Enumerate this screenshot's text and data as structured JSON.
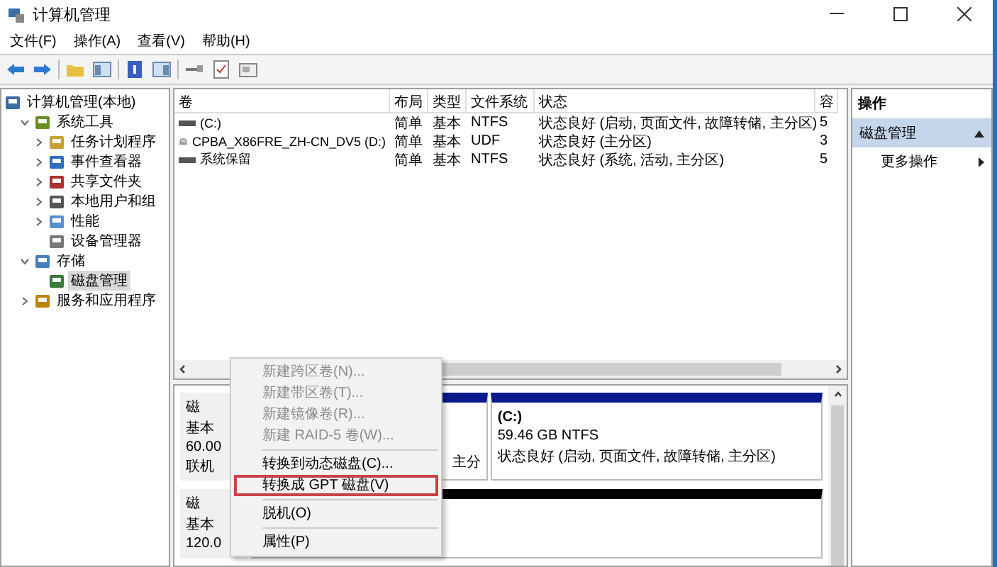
{
  "window": {
    "title": "计算机管理"
  },
  "menu_bar": [
    "文件(F)",
    "操作(A)",
    "查看(V)",
    "帮助(H)"
  ],
  "tree": [
    {
      "label": "计算机管理(本地)",
      "kind": "root",
      "selected": false,
      "children": [
        {
          "label": "系统工具",
          "kind": "branch",
          "expanded": true,
          "selected": false,
          "children": [
            {
              "label": "任务计划程序",
              "kind": "branch",
              "expanded": false,
              "selected": false
            },
            {
              "label": "事件查看器",
              "kind": "branch",
              "expanded": false,
              "selected": false
            },
            {
              "label": "共享文件夹",
              "kind": "branch",
              "expanded": false,
              "selected": false
            },
            {
              "label": "本地用户和组",
              "kind": "branch",
              "expanded": false,
              "selected": false
            },
            {
              "label": "性能",
              "kind": "branch",
              "expanded": false,
              "selected": false
            },
            {
              "label": "设备管理器",
              "kind": "leaf",
              "selected": false
            }
          ]
        },
        {
          "label": "存储",
          "kind": "branch",
          "expanded": true,
          "selected": false,
          "children": [
            {
              "label": "磁盘管理",
              "kind": "leaf",
              "selected": true
            }
          ]
        },
        {
          "label": "服务和应用程序",
          "kind": "branch",
          "expanded": false,
          "selected": false
        }
      ]
    }
  ],
  "table": {
    "columns": [
      "卷",
      "布局",
      "类型",
      "文件系统",
      "状态",
      "容"
    ],
    "rows": [
      {
        "kind": "disk",
        "cells": [
          "(C:)",
          "简单",
          "基本",
          "NTFS",
          "状态良好 (启动, 页面文件, 故障转储, 主分区)",
          "5"
        ]
      },
      {
        "kind": "cdrom",
        "cells": [
          "CPBA_X86FRE_ZH-CN_DV5 (D:)",
          "简单",
          "基本",
          "UDF",
          "状态良好 (主分区)",
          "3"
        ]
      },
      {
        "kind": "disk",
        "cells": [
          "系统保留",
          "简单",
          "基本",
          "NTFS",
          "状态良好 (系统, 活动, 主分区)",
          "5"
        ]
      }
    ]
  },
  "disks": [
    {
      "label_lines": [
        "磁",
        "基本",
        "60.00",
        "联机"
      ],
      "partitions": [
        {
          "kind": "primary",
          "lines": [
            "主分"
          ]
        },
        {
          "kind": "primary",
          "lines": [
            "(C:)",
            "59.46 GB NTFS",
            "状态良好 (启动, 页面文件, 故障转储, 主分区)"
          ]
        }
      ]
    },
    {
      "label_lines": [
        "磁",
        "基本",
        "120.0"
      ],
      "partitions": [
        {
          "kind": "unallocated"
        }
      ]
    }
  ],
  "actions": {
    "title": "操作",
    "section": {
      "label": "磁盘管理",
      "selected": true
    },
    "items": [
      {
        "label": "更多操作",
        "kind": "submenu"
      }
    ]
  },
  "context_menu": [
    {
      "kind": "item",
      "label": "新建跨区卷(N)...",
      "disabled": true,
      "highlighted": false
    },
    {
      "kind": "item",
      "label": "新建带区卷(T)...",
      "disabled": true,
      "highlighted": false
    },
    {
      "kind": "item",
      "label": "新建镜像卷(R)...",
      "disabled": true,
      "highlighted": false
    },
    {
      "kind": "item",
      "label": "新建 RAID-5 卷(W)...",
      "disabled": true,
      "highlighted": false
    },
    {
      "kind": "separator"
    },
    {
      "kind": "item",
      "label": "转换到动态磁盘(C)...",
      "disabled": false,
      "highlighted": false
    },
    {
      "kind": "item",
      "label": "转换成 GPT 磁盘(V)",
      "disabled": false,
      "highlighted": true
    },
    {
      "kind": "separator"
    },
    {
      "kind": "item",
      "label": "脱机(O)",
      "disabled": false,
      "highlighted": false
    },
    {
      "kind": "separator"
    },
    {
      "kind": "item",
      "label": "属性(P)",
      "disabled": false,
      "highlighted": false
    }
  ]
}
